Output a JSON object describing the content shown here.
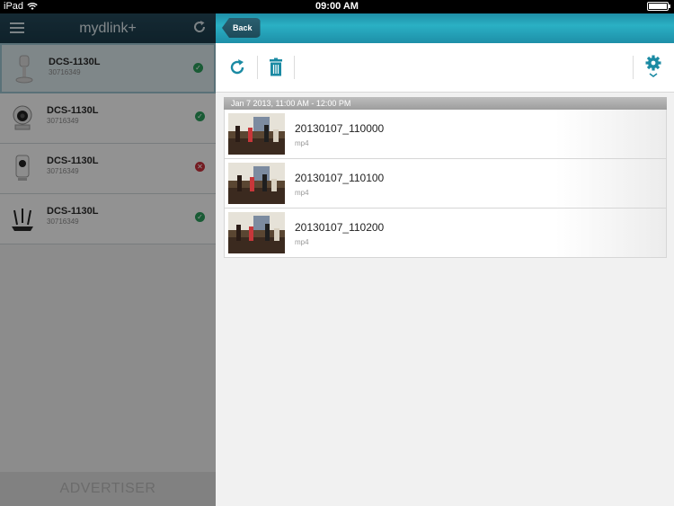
{
  "status_bar": {
    "device": "iPad",
    "time": "09:00 AM"
  },
  "sidebar": {
    "title": "mydlink+",
    "devices": [
      {
        "name": "DCS-1130L",
        "id": "30716349",
        "status": "ok",
        "selected": true,
        "icon": "camera-stand-icon"
      },
      {
        "name": "DCS-1130L",
        "id": "30716349",
        "status": "ok",
        "selected": false,
        "icon": "dome-camera-icon"
      },
      {
        "name": "DCS-1130L",
        "id": "30716349",
        "status": "error",
        "selected": false,
        "icon": "cube-camera-icon"
      },
      {
        "name": "DCS-1130L",
        "id": "30716349",
        "status": "ok",
        "selected": false,
        "icon": "router-icon"
      }
    ],
    "advertiser": "ADVERTISER"
  },
  "main": {
    "back_label": "Back",
    "group_header": "Jan 7 2013, 11:00 AM - 12:00 PM",
    "recordings": [
      {
        "title": "20130107_110000",
        "type": "mp4"
      },
      {
        "title": "20130107_110100",
        "type": "mp4"
      },
      {
        "title": "20130107_110200",
        "type": "mp4"
      }
    ]
  },
  "colors": {
    "header_teal": "#2ab0c4",
    "sidebar_header": "#1f4050",
    "icon_teal": "#1a8aa3",
    "status_ok": "#2c9d5c",
    "status_error": "#c8313c"
  }
}
